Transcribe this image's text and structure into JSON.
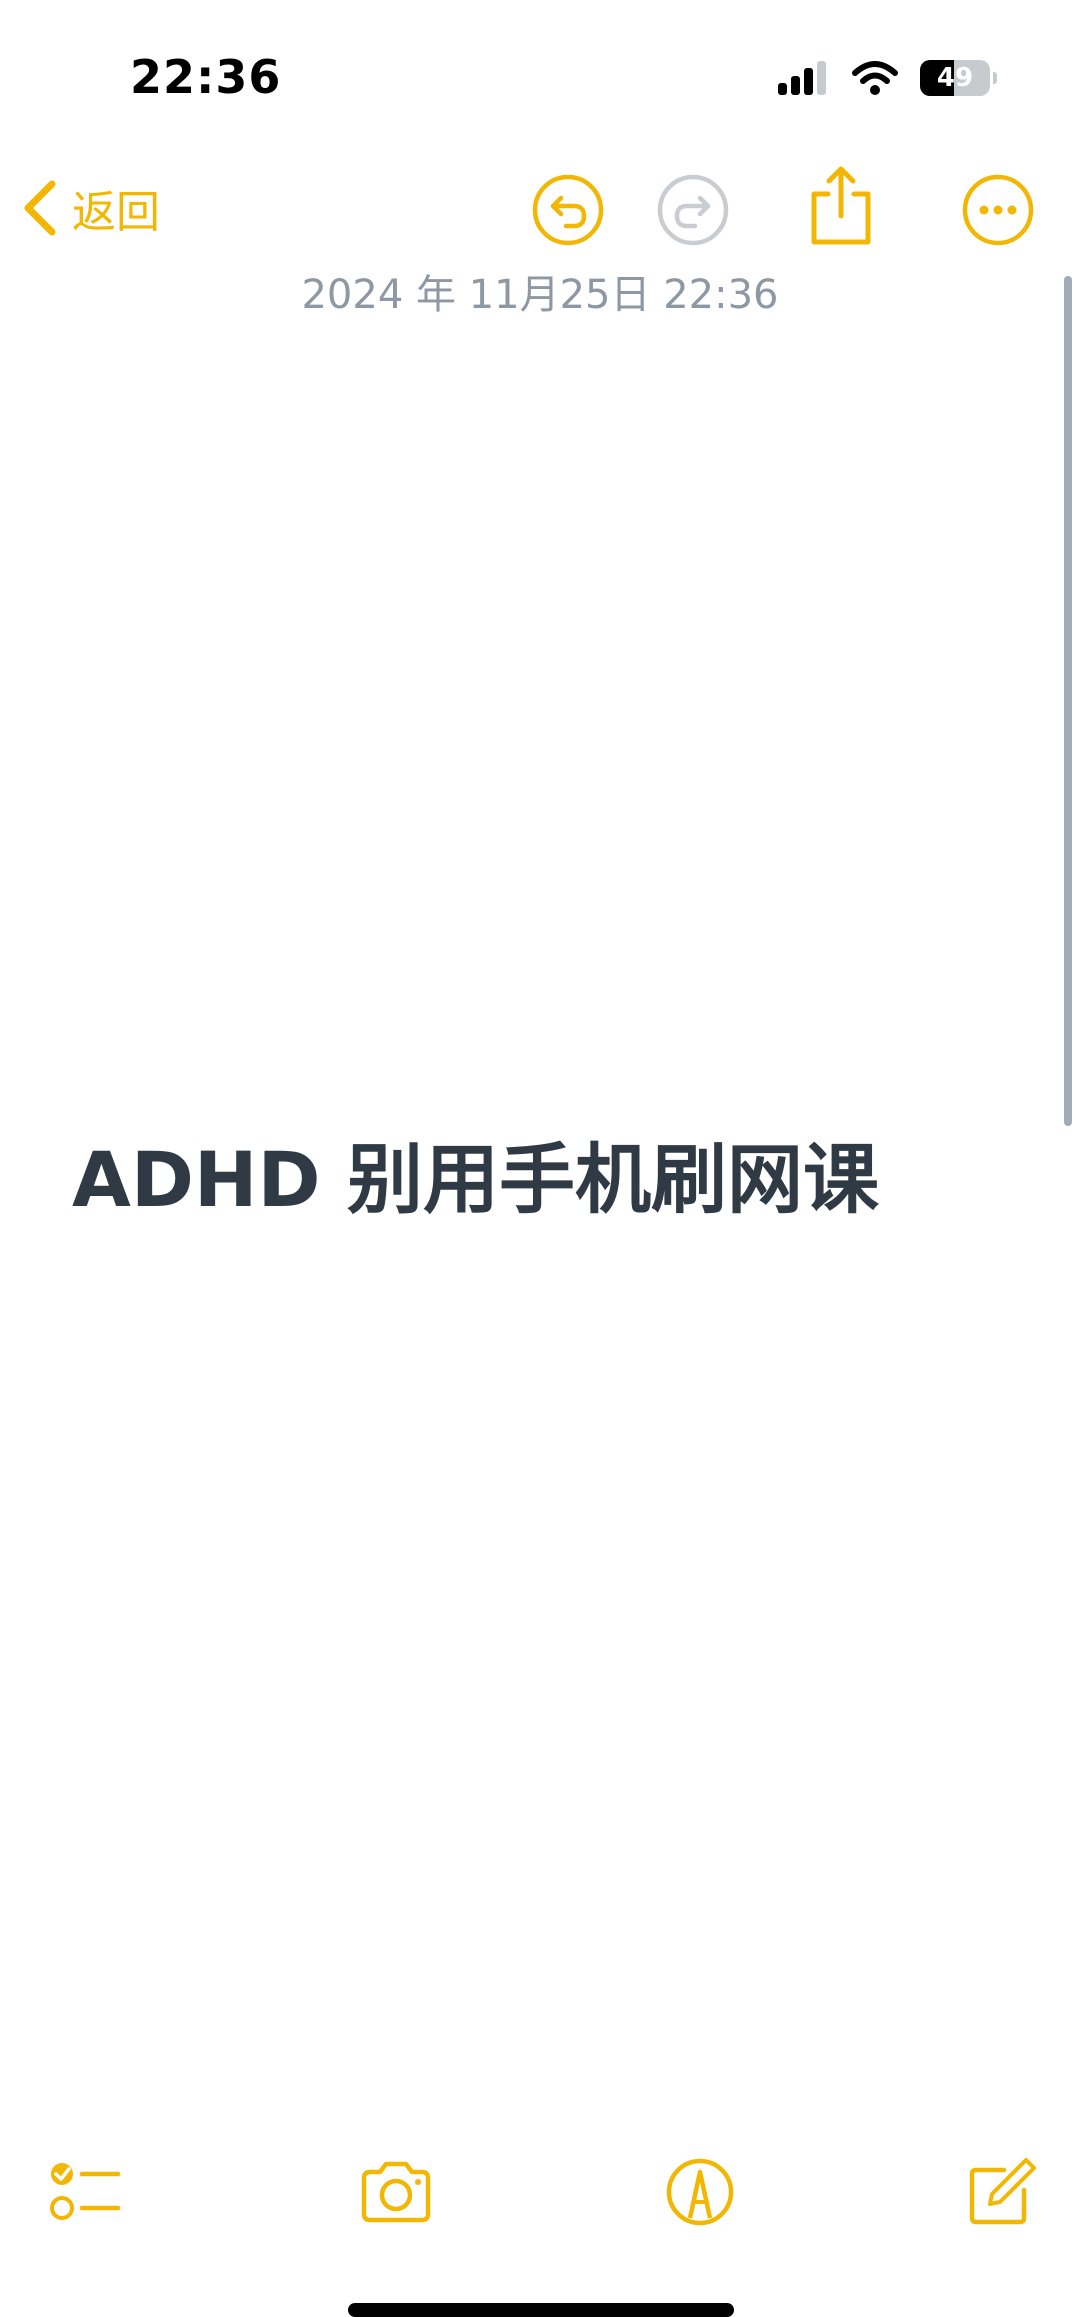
{
  "status_bar": {
    "time": "22:36",
    "battery_level": "49",
    "battery_fraction": 0.49,
    "icons": [
      "cellular-signal-icon",
      "wifi-icon",
      "battery-icon"
    ]
  },
  "nav": {
    "back_label": "返回",
    "icons": [
      "back-chevron-icon",
      "undo-icon",
      "redo-icon",
      "share-icon",
      "more-icon"
    ]
  },
  "note": {
    "date": "2024 年 11月25日 22:36",
    "title": "ADHD 别用手机刷网课"
  },
  "toolbar": {
    "icons": [
      "checklist-icon",
      "camera-icon",
      "markup-icon",
      "compose-icon"
    ]
  },
  "colors": {
    "accent": "#f2b705",
    "disabled": "#c9cdd2",
    "date_text": "#8e98a4",
    "title_text": "#2f3a44",
    "scrollbar": "#a3acb6"
  }
}
